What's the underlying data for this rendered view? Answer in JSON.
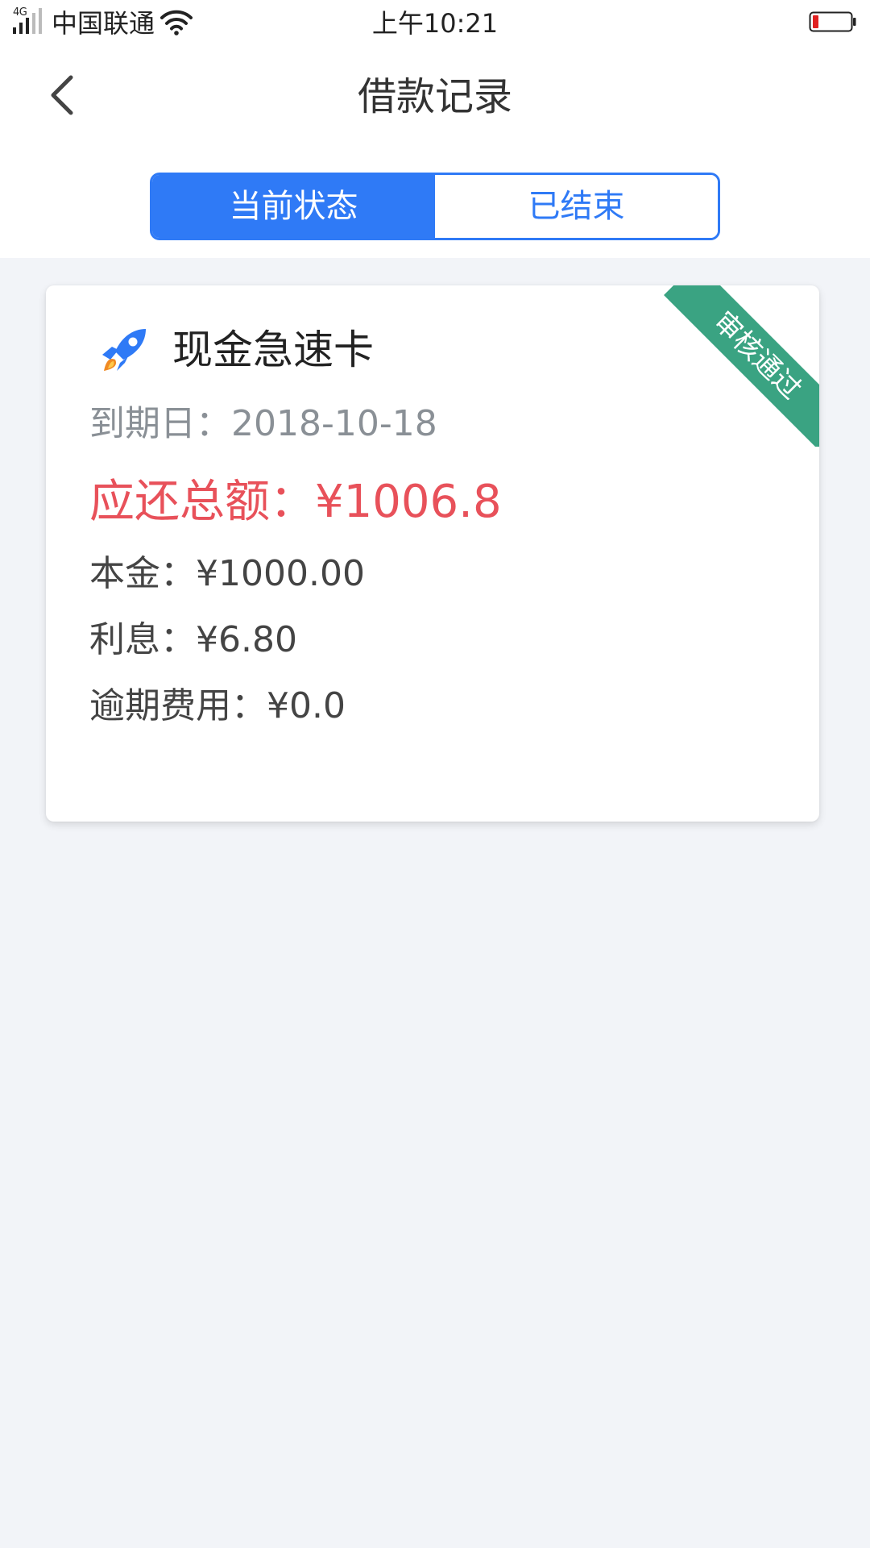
{
  "status_bar": {
    "network": "4G",
    "carrier": "中国联通",
    "time": "上午10:21"
  },
  "nav": {
    "title": "借款记录"
  },
  "tabs": [
    {
      "label": "当前状态",
      "active": true
    },
    {
      "label": "已结束",
      "active": false
    }
  ],
  "loan": {
    "product_name": "现金急速卡",
    "ribbon": "审核通过",
    "due_label": "到期日：",
    "due_date": "2018-10-18",
    "total_label": "应还总额：",
    "total_amount": "¥1006.8",
    "principal_label": "本金：",
    "principal": "¥1000.00",
    "interest_label": "利息：",
    "interest": "¥6.80",
    "overdue_label": "逾期费用：",
    "overdue": "¥0.0"
  },
  "colors": {
    "accent": "#2f7af6",
    "total_red": "#e8515a",
    "ribbon_green": "#3aa382",
    "battery_low": "#e02020"
  },
  "icons": {
    "back": "chevron-left-icon",
    "product": "rocket-icon",
    "wifi": "wifi-icon",
    "signal": "signal-icon",
    "battery": "battery-icon"
  }
}
